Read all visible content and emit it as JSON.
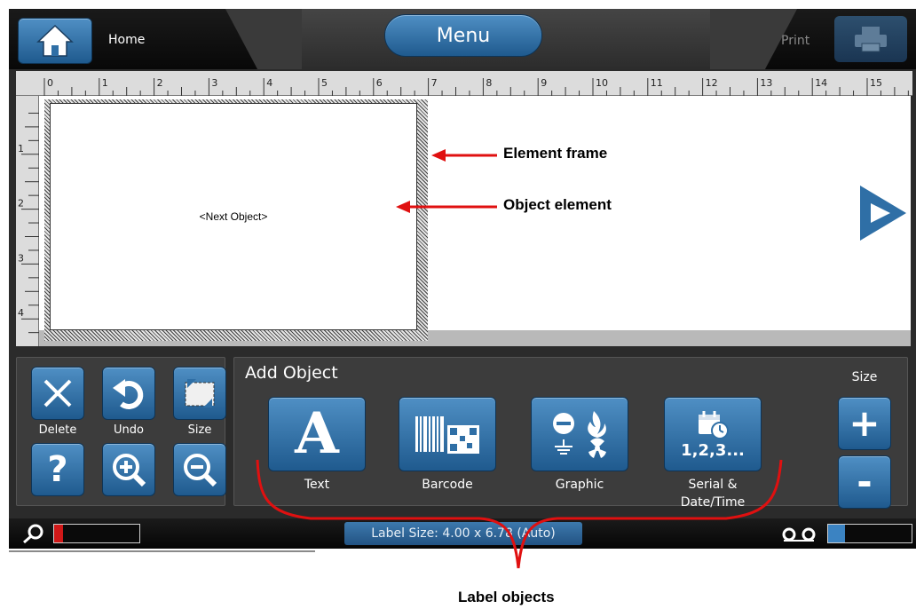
{
  "topbar": {
    "home_label": "Home",
    "menu_label": "Menu",
    "print_label": "Print"
  },
  "ruler": {
    "horizontal": [
      "0",
      "1",
      "2",
      "3",
      "4",
      "5",
      "6",
      "7",
      "8",
      "9",
      "10",
      "11",
      "12",
      "13",
      "14",
      "15"
    ],
    "vertical": [
      "1",
      "2",
      "3",
      "4"
    ]
  },
  "canvas": {
    "object_text": "<Next Object>"
  },
  "edit_panel": {
    "buttons": [
      {
        "label": "Delete",
        "icon": "x-icon"
      },
      {
        "label": "Undo",
        "icon": "undo-icon"
      },
      {
        "label": "Size",
        "icon": "resize-icon"
      },
      {
        "label": "",
        "icon": "help-icon"
      },
      {
        "label": "",
        "icon": "zoom-in-icon"
      },
      {
        "label": "",
        "icon": "zoom-out-icon"
      }
    ]
  },
  "add_panel": {
    "title": "Add Object",
    "objects": [
      {
        "label": "Text",
        "icon": "text-icon"
      },
      {
        "label": "Barcode",
        "icon": "barcode-icon"
      },
      {
        "label": "Graphic",
        "icon": "graphic-icon"
      },
      {
        "label_line1": "Serial &",
        "label_line2": "Date/Time",
        "icon": "serial-date-icon",
        "icon_text": "1,2,3..."
      }
    ],
    "size_title": "Size",
    "size_plus": "+",
    "size_minus": "-"
  },
  "statusbar": {
    "label_size": "Label Size: 4.00 x 6.78 (Auto)",
    "ribbon_level": 0.1,
    "label_supply_level": 0.2
  },
  "annotations": {
    "element_frame": "Element frame",
    "object_element": "Object element",
    "label_objects": "Label objects"
  },
  "colors": {
    "accent_blue": "#2f6fa6",
    "annotation_red": "#e01010",
    "screen_bg": "#2b2b2b"
  }
}
